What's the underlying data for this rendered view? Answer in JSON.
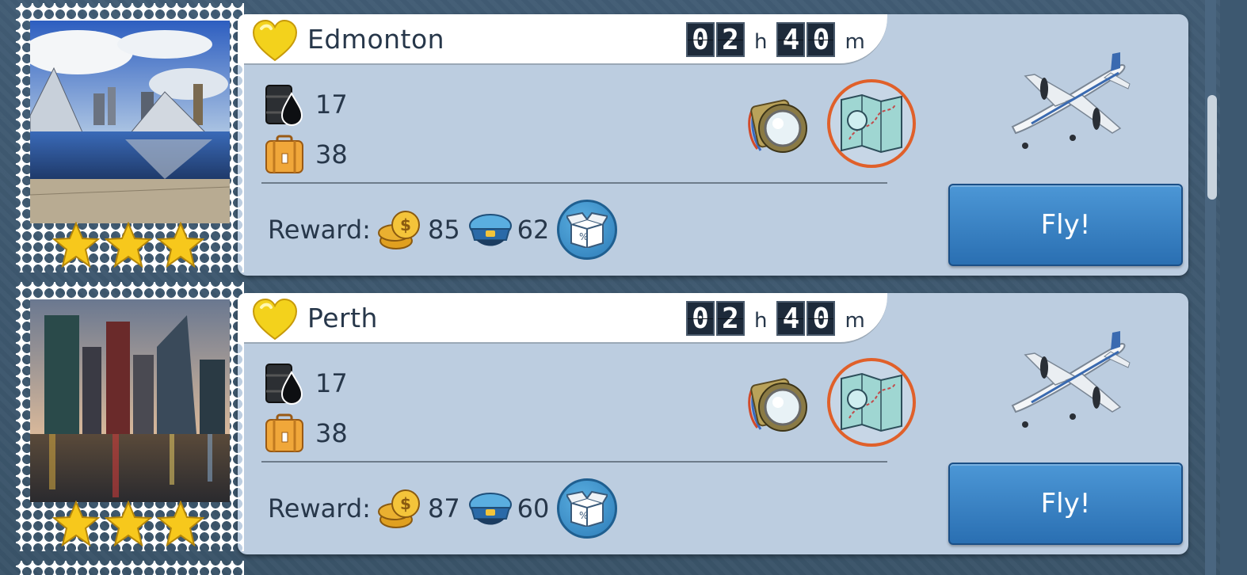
{
  "colors": {
    "accent_orange": "#e0602a",
    "fly_blue": "#2a6fb2",
    "panel": "#bccde0"
  },
  "flights": [
    {
      "city": "Edmonton",
      "timer": {
        "hours": "02",
        "hours_unit": "h",
        "minutes": "40",
        "minutes_unit": "m"
      },
      "fuel": "17",
      "cargo": "38",
      "reward_label": "Reward:",
      "coins": "85",
      "crew": "62",
      "fly_label": "Fly!",
      "stars": 3
    },
    {
      "city": "Perth",
      "timer": {
        "hours": "02",
        "hours_unit": "h",
        "minutes": "40",
        "minutes_unit": "m"
      },
      "fuel": "17",
      "cargo": "38",
      "reward_label": "Reward:",
      "coins": "87",
      "crew": "60",
      "fly_label": "Fly!",
      "stars": 3
    }
  ]
}
